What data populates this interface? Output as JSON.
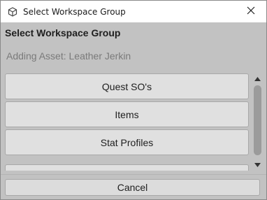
{
  "window": {
    "title": "Select Workspace Group",
    "app_icon": "unity-cube-icon",
    "close_icon": "close-icon"
  },
  "dialog": {
    "heading": "Select Workspace Group",
    "subheading": "Adding Asset: Leather Jerkin"
  },
  "groups": [
    {
      "label": "Quest SO's"
    },
    {
      "label": "Items"
    },
    {
      "label": "Stat Profiles"
    },
    {
      "label": ""
    }
  ],
  "scrollbar": {
    "up_icon": "arrow-up-icon",
    "down_icon": "arrow-down-icon"
  },
  "footer": {
    "cancel_label": "Cancel"
  }
}
